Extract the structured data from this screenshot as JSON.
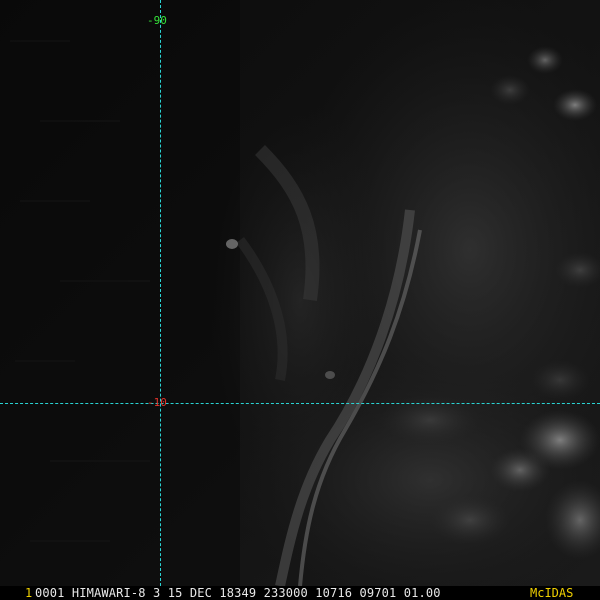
{
  "overlay": {
    "grid_labels": {
      "top": "-90",
      "middle": "-10"
    },
    "colors": {
      "grid_line": "#2ad4d4",
      "label_top": "#36e33a",
      "label_middle": "#e2332a",
      "status_text": "#e8e8e8",
      "frame_number": "#f0d000",
      "brand": "#f0d000"
    }
  },
  "status_bar": {
    "frame_number": "1",
    "text": "0001 HIMAWARI-8  3 15 DEC 18349 233000 10716 09701 01.00",
    "brand": "McIDAS"
  }
}
